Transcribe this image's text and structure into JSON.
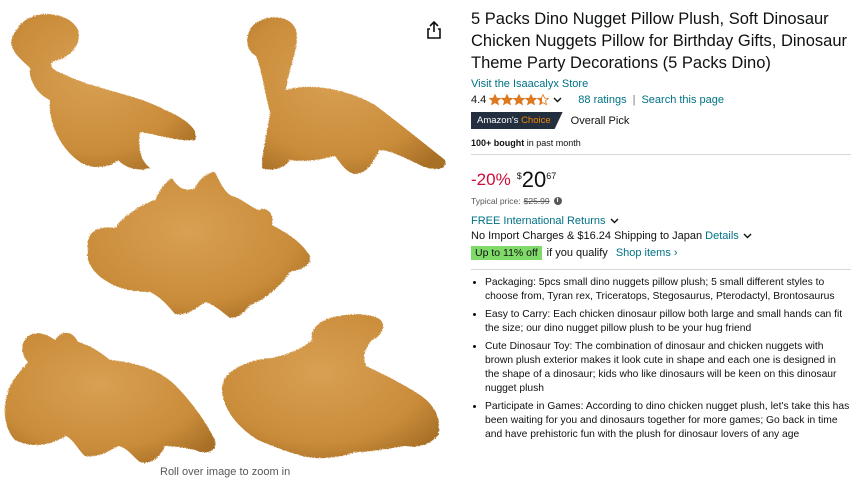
{
  "gallery": {
    "rollover_text": "Roll over image to zoom in",
    "share_icon": "share-icon",
    "nugget_color": "#C98C3A"
  },
  "product": {
    "title": "5 Packs Dino Nugget Pillow Plush, Soft Dinosaur Chicken Nuggets Pillow for Birthday Gifts, Dinosaur Theme Party Decorations (5 Packs Dino)",
    "store_link": "Visit the Isaacalyx Store",
    "rating_value": "4.4",
    "rating_stars": 4.4,
    "ratings_count": "88 ratings",
    "search_page": "Search this page",
    "choice_prefix": "Amazon's",
    "choice_highlight": "Choice",
    "overall_pick": "Overall Pick",
    "bought_bold": "100+ bought",
    "bought_rest": " in past month"
  },
  "pricing": {
    "discount": "-20%",
    "currency": "$",
    "whole": "20",
    "fraction": "67",
    "typical_label": "Typical price:",
    "typical_price": "$25.99",
    "returns": "FREE International Returns",
    "import_charges": "No Import Charges & $16.24 Shipping to Japan",
    "details_link": "Details",
    "promo_badge": "Up to 11% off",
    "promo_qualify": "if you qualify",
    "shop_items": "Shop items ›"
  },
  "bullets": [
    "Packaging: 5pcs small dino nuggets pillow plush; 5 small different styles to choose from, Tyran rex, Triceratops, Stegosaurus, Pterodactyl, Brontosaurus",
    "Easy to Carry: Each chicken dinosaur pillow both large and small hands can fit the size; our dino nugget pillow plush to be your hug friend",
    "Cute Dinosaur Toy: The combination of dinosaur and chicken nuggets with brown plush exterior makes it look cute in shape and each one is designed in the shape of a dinosaur; kids who like dinosaurs will be keen on this dinosaur nugget plush",
    "Participate in Games: According to dino chicken nugget plush, let's take this has been waiting for you and dinosaurs together for more games; Go back in time and have prehistoric fun with the plush for dinosaur lovers of any age"
  ],
  "colors": {
    "link": "#007185",
    "discount": "#CC0C39",
    "star": "#DE7921",
    "promo_bg": "#7FDA69",
    "badge_bg": "#232F3E"
  }
}
